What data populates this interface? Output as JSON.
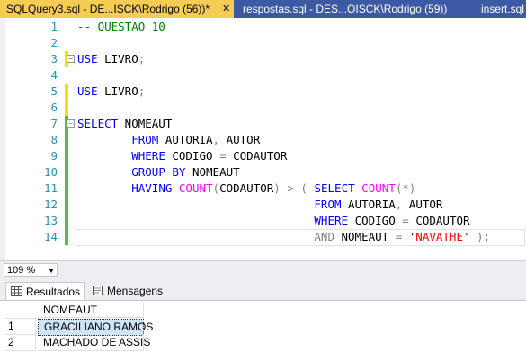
{
  "tabs": [
    {
      "label": "SQLQuery3.sql - DE...ISCK\\Rodrigo (56))*",
      "close": "✕"
    },
    {
      "label": "respostas.sql - DES...OISCK\\Rodrigo (59))"
    },
    {
      "label": "insert.sql"
    }
  ],
  "editor": {
    "lines": [
      {
        "n": "1",
        "parts": [
          {
            "t": "-- QUESTAO 10",
            "c": "cm"
          }
        ]
      },
      {
        "n": "2",
        "parts": []
      },
      {
        "n": "3",
        "parts": [
          {
            "t": "USE",
            "c": "kw"
          },
          {
            "t": " LIVRO",
            "c": ""
          },
          {
            "t": ";",
            "c": "op"
          }
        ]
      },
      {
        "n": "4",
        "parts": []
      },
      {
        "n": "5",
        "parts": [
          {
            "t": "USE",
            "c": "kw"
          },
          {
            "t": " LIVRO",
            "c": ""
          },
          {
            "t": ";",
            "c": "op"
          }
        ]
      },
      {
        "n": "6",
        "parts": []
      },
      {
        "n": "7",
        "parts": [
          {
            "t": "SELECT",
            "c": "kw"
          },
          {
            "t": " NOMEAUT",
            "c": ""
          }
        ]
      },
      {
        "n": "8",
        "parts": [
          {
            "t": "        ",
            "c": ""
          },
          {
            "t": "FROM",
            "c": "kw"
          },
          {
            "t": " AUTORIA",
            "c": ""
          },
          {
            "t": ",",
            "c": "op"
          },
          {
            "t": " AUTOR",
            "c": ""
          }
        ]
      },
      {
        "n": "9",
        "parts": [
          {
            "t": "        ",
            "c": ""
          },
          {
            "t": "WHERE",
            "c": "kw"
          },
          {
            "t": " CODIGO ",
            "c": ""
          },
          {
            "t": "=",
            "c": "op"
          },
          {
            "t": " CODAUTOR",
            "c": ""
          }
        ]
      },
      {
        "n": "10",
        "parts": [
          {
            "t": "        ",
            "c": ""
          },
          {
            "t": "GROUP BY",
            "c": "kw"
          },
          {
            "t": " NOMEAUT",
            "c": ""
          }
        ]
      },
      {
        "n": "11",
        "parts": [
          {
            "t": "        ",
            "c": ""
          },
          {
            "t": "HAVING",
            "c": "kw"
          },
          {
            "t": " ",
            "c": ""
          },
          {
            "t": "COUNT",
            "c": "fn"
          },
          {
            "t": "(",
            "c": "op"
          },
          {
            "t": "CODAUTOR",
            "c": ""
          },
          {
            "t": ")",
            "c": "op"
          },
          {
            "t": " ",
            "c": ""
          },
          {
            "t": ">",
            "c": "op"
          },
          {
            "t": " ",
            "c": ""
          },
          {
            "t": "(",
            "c": "op"
          },
          {
            "t": " ",
            "c": ""
          },
          {
            "t": "SELECT",
            "c": "kw"
          },
          {
            "t": " ",
            "c": ""
          },
          {
            "t": "COUNT",
            "c": "fn"
          },
          {
            "t": "(*)",
            "c": "op"
          }
        ]
      },
      {
        "n": "12",
        "parts": [
          {
            "t": "                                   ",
            "c": ""
          },
          {
            "t": "FROM",
            "c": "kw"
          },
          {
            "t": " AUTORIA",
            "c": ""
          },
          {
            "t": ",",
            "c": "op"
          },
          {
            "t": " AUTOR",
            "c": ""
          }
        ]
      },
      {
        "n": "13",
        "parts": [
          {
            "t": "                                   ",
            "c": ""
          },
          {
            "t": "WHERE",
            "c": "kw"
          },
          {
            "t": " CODIGO ",
            "c": ""
          },
          {
            "t": "=",
            "c": "op"
          },
          {
            "t": " CODAUTOR",
            "c": ""
          }
        ]
      },
      {
        "n": "14",
        "parts": [
          {
            "t": "                                   ",
            "c": ""
          },
          {
            "t": "AND",
            "c": "op"
          },
          {
            "t": " NOMEAUT ",
            "c": ""
          },
          {
            "t": "=",
            "c": "op"
          },
          {
            "t": " ",
            "c": ""
          },
          {
            "t": "'NAVATHE'",
            "c": "str"
          },
          {
            "t": " ",
            "c": ""
          },
          {
            "t": ");",
            "c": "op"
          }
        ]
      }
    ]
  },
  "zoom": {
    "value": "109 %",
    "arrow": "▼"
  },
  "results_tabs": [
    {
      "label": "Resultados"
    },
    {
      "label": "Mensagens"
    }
  ],
  "grid": {
    "column": "NOMEAUT",
    "rows": [
      {
        "num": "1",
        "value": "GRACILIANO RAMOS"
      },
      {
        "num": "2",
        "value": "MACHADO DE ASSIS"
      }
    ]
  }
}
